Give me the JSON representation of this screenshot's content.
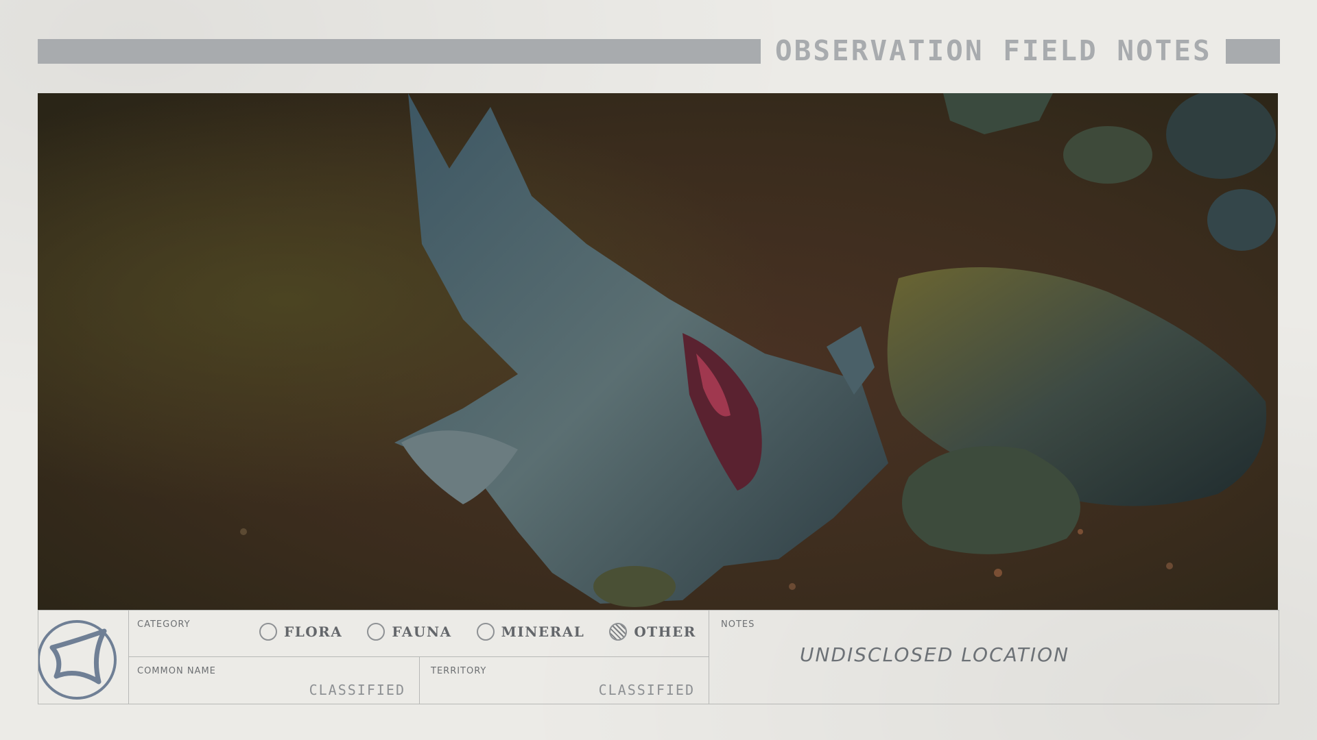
{
  "header": {
    "title": "OBSERVATION FIELD NOTES"
  },
  "photo": {
    "subject": "creature-carcass-on-ground"
  },
  "form": {
    "category": {
      "label": "CATEGORY",
      "options": [
        {
          "label": "FLORA",
          "selected": false
        },
        {
          "label": "FAUNA",
          "selected": false
        },
        {
          "label": "MINERAL",
          "selected": false
        },
        {
          "label": "OTHER",
          "selected": true
        }
      ]
    },
    "common_name": {
      "label": "COMMON NAME",
      "value": "CLASSIFIED"
    },
    "territory": {
      "label": "TERRITORY",
      "value": "CLASSIFIED"
    },
    "notes": {
      "label": "NOTES",
      "value": "UNDISCLOSED LOCATION"
    }
  },
  "colors": {
    "paper": "#ecebe7",
    "header_gray": "#a8abae",
    "ink": "#63666a",
    "logo_blue": "#6f7f95"
  },
  "icons": {
    "logo": "four-point-star-emblem-icon"
  }
}
